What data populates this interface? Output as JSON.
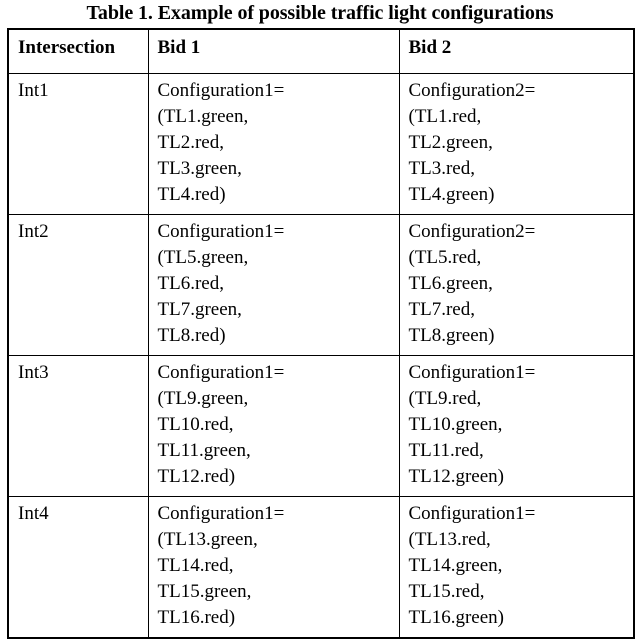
{
  "caption": "Table 1. Example of possible traffic light configurations",
  "table": {
    "columns": [
      "Intersection",
      "Bid 1",
      "Bid 2"
    ],
    "rows": [
      {
        "intersection": "Int1",
        "bid1": {
          "header": "Configuration1=",
          "lines": [
            "(TL1.green,",
            "TL2.red,",
            "TL3.green,",
            "TL4.red)"
          ]
        },
        "bid2": {
          "header": "Configuration2=",
          "lines": [
            "(TL1.red,",
            "TL2.green,",
            "TL3.red,",
            "TL4.green)"
          ]
        }
      },
      {
        "intersection": "Int2",
        "bid1": {
          "header": "Configuration1=",
          "lines": [
            "(TL5.green,",
            "TL6.red,",
            "TL7.green,",
            "TL8.red)"
          ]
        },
        "bid2": {
          "header": "Configuration2=",
          "lines": [
            "(TL5.red,",
            "TL6.green,",
            "TL7.red,",
            "TL8.green)"
          ]
        }
      },
      {
        "intersection": "Int3",
        "bid1": {
          "header": "Configuration1=",
          "lines": [
            "(TL9.green,",
            "TL10.red,",
            "TL11.green,",
            "TL12.red)"
          ]
        },
        "bid2": {
          "header": "Configuration1=",
          "lines": [
            "(TL9.red,",
            "TL10.green,",
            "TL11.red,",
            "TL12.green)"
          ]
        }
      },
      {
        "intersection": "Int4",
        "bid1": {
          "header": "Configuration1=",
          "lines": [
            "(TL13.green,",
            "TL14.red,",
            "TL15.green,",
            "TL16.red)"
          ]
        },
        "bid2": {
          "header": "Configuration1=",
          "lines": [
            "(TL13.red,",
            "TL14.green,",
            "TL15.red,",
            "TL16.green)"
          ]
        }
      }
    ]
  },
  "colors": {
    "text": "#000000",
    "border": "#000000",
    "background": "#ffffff"
  }
}
